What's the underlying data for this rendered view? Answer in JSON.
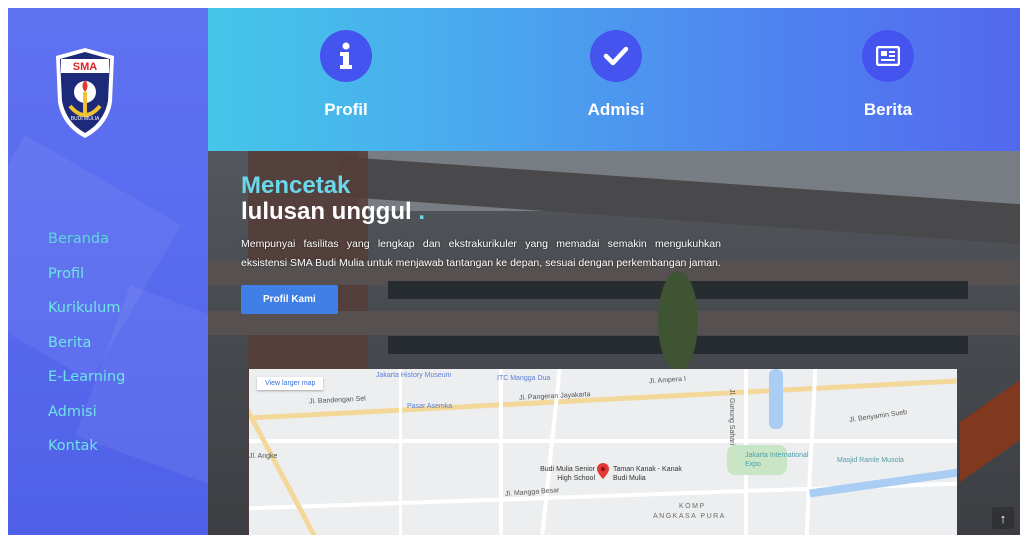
{
  "logo": {
    "text": "SMA",
    "motto": "BUDI MULIA"
  },
  "sidebar": {
    "items": [
      {
        "label": "Beranda"
      },
      {
        "label": "Profil"
      },
      {
        "label": "Kurikulum"
      },
      {
        "label": "Berita"
      },
      {
        "label": "E-Learning"
      },
      {
        "label": "Admisi"
      },
      {
        "label": "Kontak"
      }
    ]
  },
  "features": [
    {
      "label": "Profil",
      "icon": "info-icon"
    },
    {
      "label": "Admisi",
      "icon": "check-icon"
    },
    {
      "label": "Berita",
      "icon": "newspaper-icon"
    }
  ],
  "hero": {
    "title_line1": "Mencetak",
    "title_line2": "lulusan unggul",
    "title_dot": ".",
    "description": "Mempunyai fasilitas yang lengkap dan ekstrakurikuler yang memadai semakin mengukuhkan eksistensi SMA Budi Mulia untuk menjawab tantangan ke depan, sesuai dengan perkembangan jaman.",
    "button_label": "Profil Kami"
  },
  "map": {
    "view_larger": "View larger map",
    "labels": {
      "museum": "Jakarta History Museum",
      "itc": "ITC Mangga Dua",
      "pasar": "Pasar Asemka",
      "school": "Budi Mulia Senior High School",
      "taman": "Taman Kanak - Kanak Budi Mulia",
      "expo": "Jakarta International Expo",
      "masjid": "Masjid Ramle Musola",
      "komp": "KOMP",
      "angkasa": "ANGKASA PURA",
      "mangga_besar": "Jl. Mangga Besar",
      "gunung_sahari": "Jl. Gunung Sahari",
      "pangeran": "Jl. Pangeran Jayakarta",
      "ampera": "Jl. Ampera I",
      "bandengan": "Jl. Bandengan Sel",
      "benyamin": "Jl. Benyamin Sueb",
      "angke": "Jl. Angke"
    }
  },
  "scroll_top": "↑",
  "colors": {
    "sidebar": "#5a6cf0",
    "menu_text": "#6fe3e6",
    "icon_circle": "#4554ee",
    "accent": "#6ad7ea",
    "button": "#3f7fe6"
  }
}
